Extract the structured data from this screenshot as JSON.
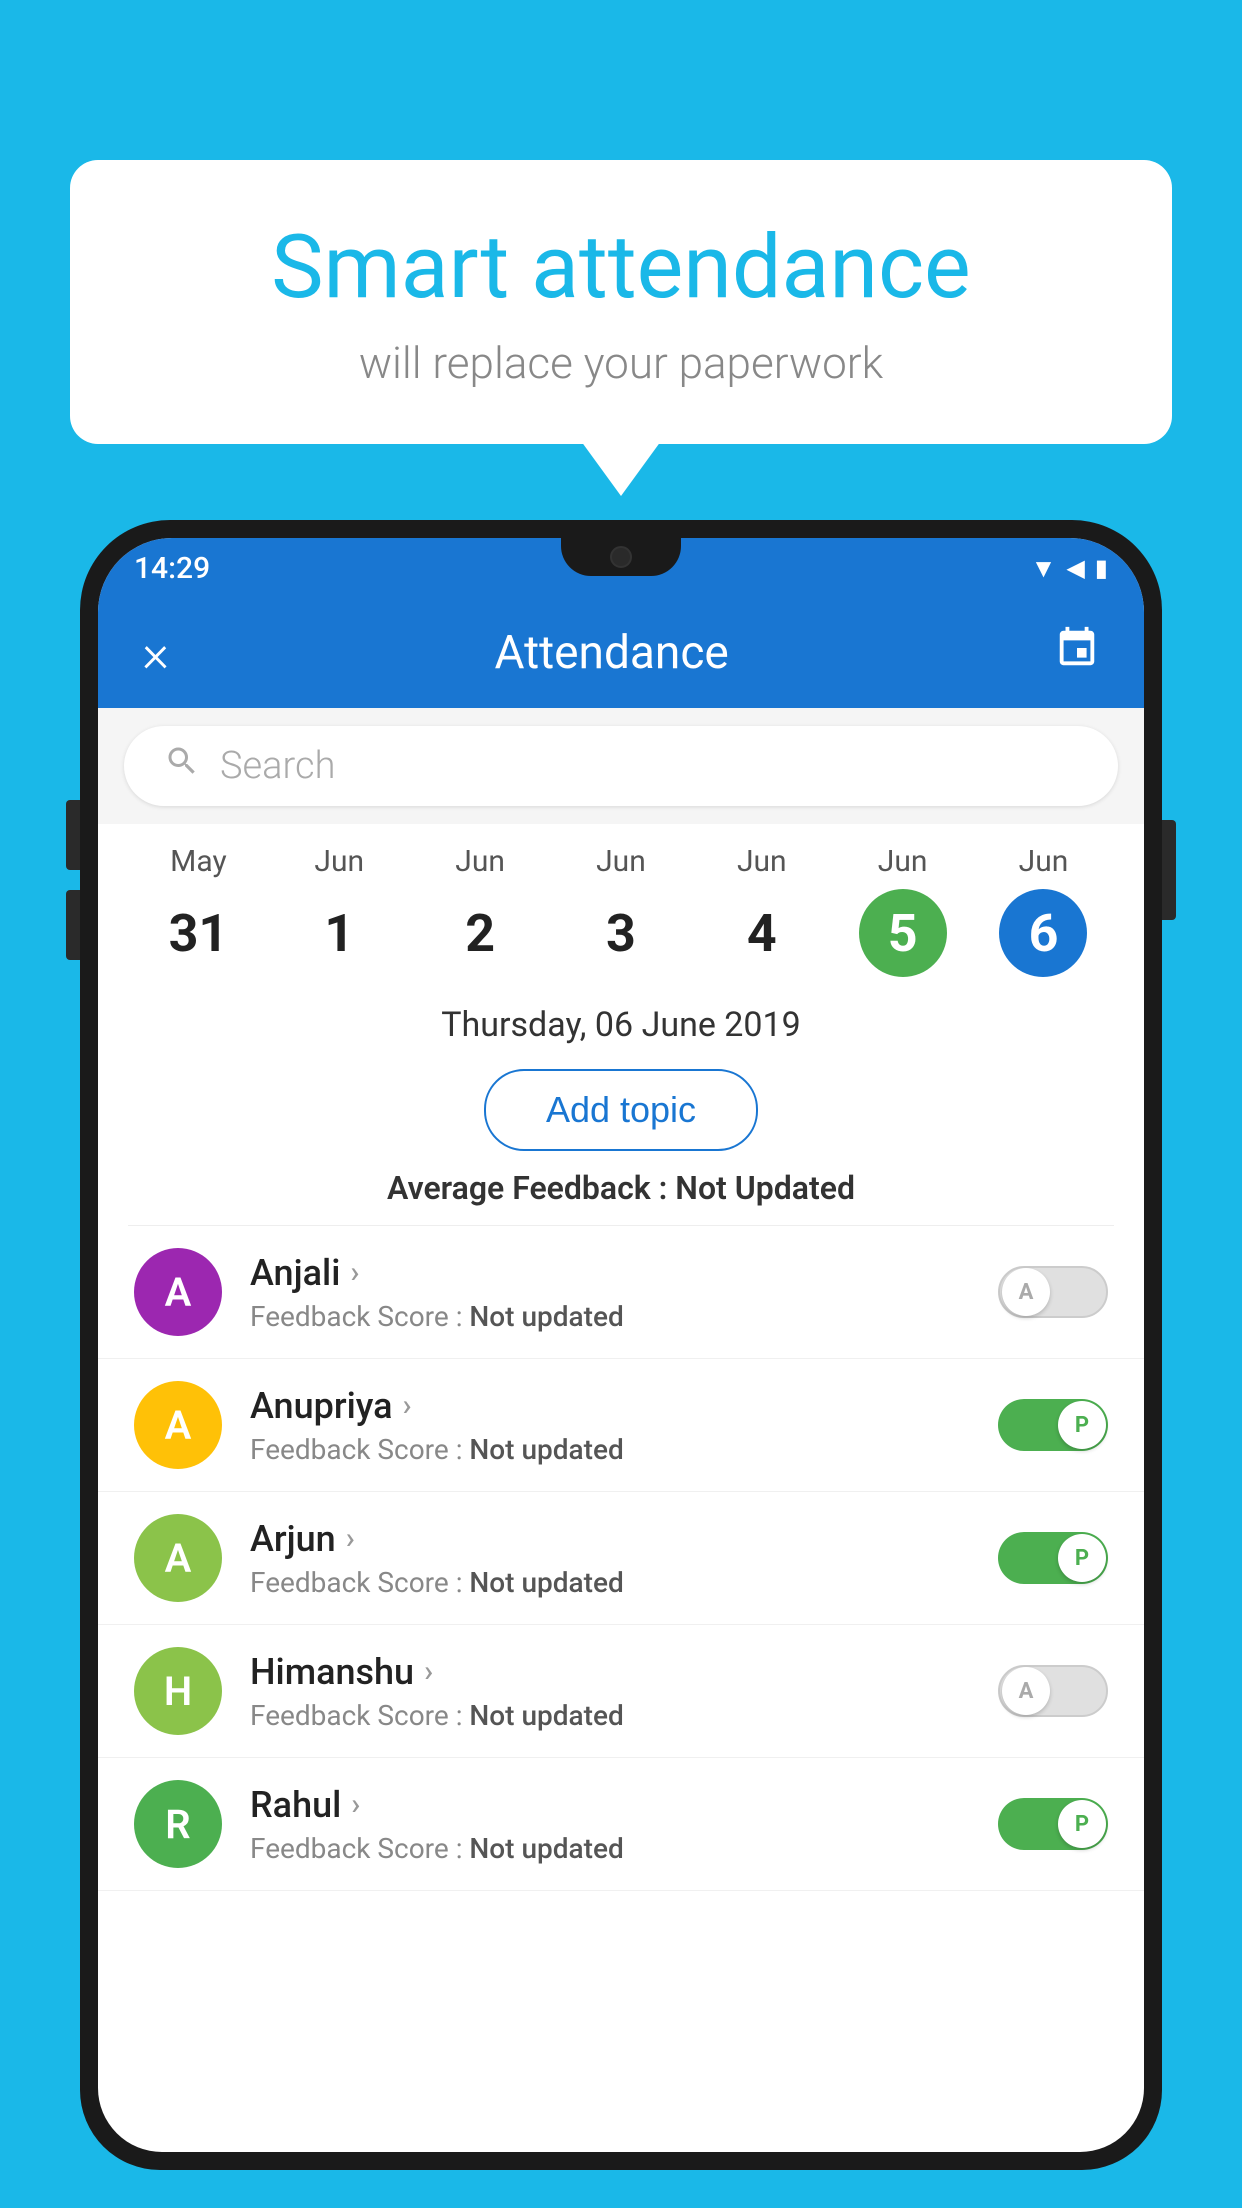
{
  "background_color": "#1ab8e8",
  "bubble": {
    "title": "Smart attendance",
    "subtitle": "will replace your paperwork"
  },
  "app": {
    "header": {
      "title": "Attendance",
      "close_label": "×",
      "calendar_icon": "📅"
    },
    "status_bar": {
      "time": "14:29"
    },
    "search": {
      "placeholder": "Search"
    },
    "calendar": {
      "days": [
        {
          "month": "May",
          "date": "31",
          "style": "normal"
        },
        {
          "month": "Jun",
          "date": "1",
          "style": "normal"
        },
        {
          "month": "Jun",
          "date": "2",
          "style": "normal"
        },
        {
          "month": "Jun",
          "date": "3",
          "style": "normal"
        },
        {
          "month": "Jun",
          "date": "4",
          "style": "normal"
        },
        {
          "month": "Jun",
          "date": "5",
          "style": "today"
        },
        {
          "month": "Jun",
          "date": "6",
          "style": "selected"
        }
      ]
    },
    "selected_date": "Thursday, 06 June 2019",
    "add_topic_label": "Add topic",
    "avg_feedback_label": "Average Feedback :",
    "avg_feedback_value": "Not Updated",
    "students": [
      {
        "name": "Anjali",
        "avatar_letter": "A",
        "avatar_color": "#9c27b0",
        "feedback": "Not updated",
        "toggle": "off",
        "toggle_label": "A"
      },
      {
        "name": "Anupriya",
        "avatar_letter": "A",
        "avatar_color": "#ffc107",
        "feedback": "Not updated",
        "toggle": "on",
        "toggle_label": "P"
      },
      {
        "name": "Arjun",
        "avatar_letter": "A",
        "avatar_color": "#8bc34a",
        "feedback": "Not updated",
        "toggle": "on",
        "toggle_label": "P"
      },
      {
        "name": "Himanshu",
        "avatar_letter": "H",
        "avatar_color": "#8bc34a",
        "feedback": "Not updated",
        "toggle": "off",
        "toggle_label": "A"
      },
      {
        "name": "Rahul",
        "avatar_letter": "R",
        "avatar_color": "#4caf50",
        "feedback": "Not updated",
        "toggle": "on",
        "toggle_label": "P"
      }
    ],
    "feedback_score_label": "Feedback Score :"
  }
}
